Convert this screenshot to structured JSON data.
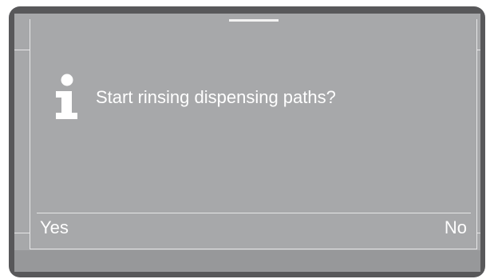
{
  "dialog": {
    "icon": "info-icon",
    "message": "Start rinsing dispensing paths?"
  },
  "softkeys": {
    "left_label": "Yes",
    "right_label": "No"
  },
  "colors": {
    "bezel": "#58585a",
    "screen": "#a7a8aa",
    "text": "#ffffff"
  }
}
